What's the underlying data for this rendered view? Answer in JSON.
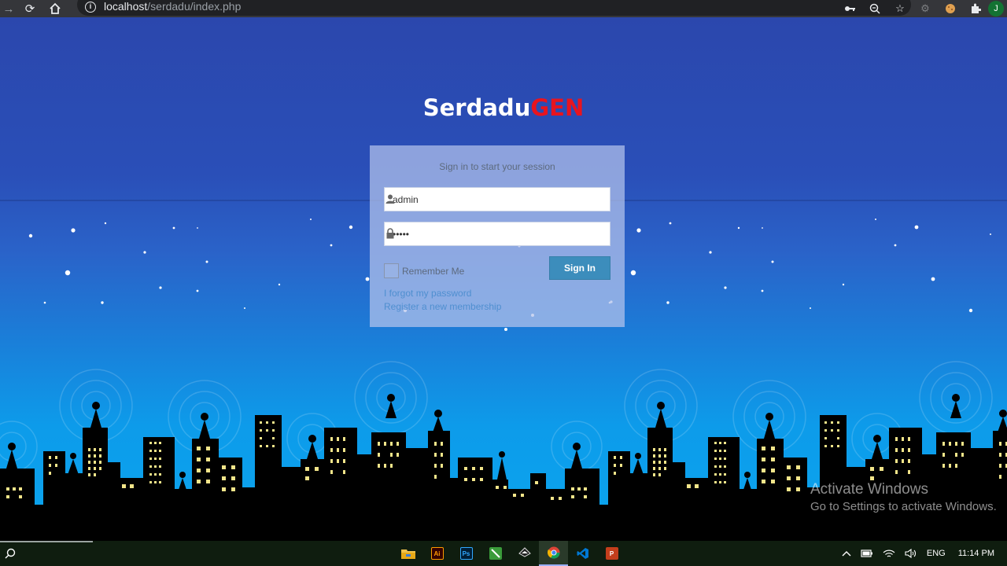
{
  "browser": {
    "url_host": "localhost",
    "url_path": "/serdadu/index.php",
    "profile_initial": "J"
  },
  "brand": {
    "part1": "Serdadu",
    "part2": "GEN"
  },
  "login": {
    "message": "Sign in to start your session",
    "username_value": "admin",
    "password_value": "admin",
    "remember_label": "Remember Me",
    "signin_label": "Sign In",
    "forgot_link": "I forgot my password",
    "register_link": "Register a new membership"
  },
  "watermark": {
    "line1": "Activate Windows",
    "line2": "Go to Settings to activate Windows."
  },
  "taskbar": {
    "apps": [
      {
        "name": "file-explorer",
        "glyph": "",
        "color": "#f0c14b"
      },
      {
        "name": "adobe-illustrator",
        "glyph": "Ai",
        "color": "#330000"
      },
      {
        "name": "photoshop",
        "glyph": "Ps",
        "color": "#001e36"
      },
      {
        "name": "drawing-app",
        "glyph": "",
        "color": "#3a9b3a"
      },
      {
        "name": "inkscape",
        "glyph": "",
        "color": "#222222"
      },
      {
        "name": "chrome",
        "glyph": "",
        "color": "#ffffff"
      },
      {
        "name": "vscode",
        "glyph": "",
        "color": "#0078d4"
      },
      {
        "name": "powerpoint",
        "glyph": "P",
        "color": "#c43e1c"
      }
    ],
    "lang": "ENG",
    "time": "11:14 PM"
  },
  "colors": {
    "brand_accent": "#e8141f",
    "button": "#3c8dbc",
    "link": "#4f8fd0"
  }
}
